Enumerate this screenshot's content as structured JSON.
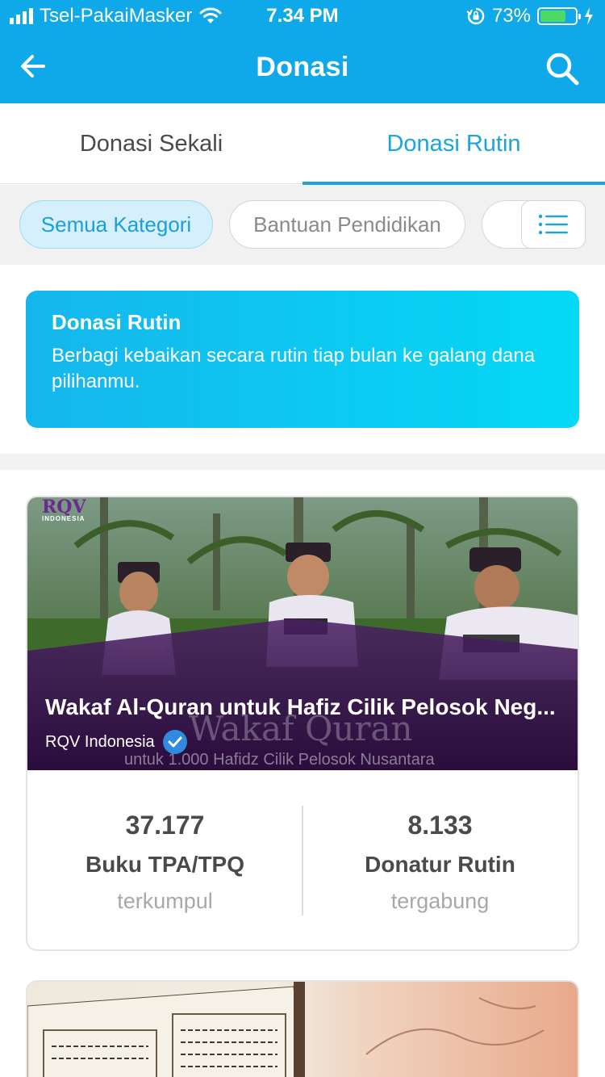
{
  "status_bar": {
    "carrier": "Tsel-PakaiMasker",
    "time": "7.34 PM",
    "battery_percent": "73%",
    "battery_level": 0.73
  },
  "nav": {
    "title": "Donasi",
    "back_icon": "back-arrow-icon",
    "search_icon": "search-icon"
  },
  "tabs": [
    {
      "label": "Donasi Sekali",
      "active": false
    },
    {
      "label": "Donasi Rutin",
      "active": true
    }
  ],
  "filters": {
    "chips": [
      {
        "label": "Semua Kategori",
        "active": true
      },
      {
        "label": "Bantuan Pendidikan",
        "active": false
      }
    ],
    "list_icon": "list-icon"
  },
  "banner": {
    "title": "Donasi Rutin",
    "text": "Berbagi kebaikan secara rutin tiap bulan ke galang dana pilihanmu."
  },
  "campaigns": [
    {
      "title": "Wakaf Al-Quran untuk Hafiz Cilik Pelosok Neg...",
      "org": "RQV Indonesia",
      "verified": true,
      "image_watermark_big": "Wakaf Quran",
      "image_watermark_small": "untuk 1.000 Hafidz Cilik Pelosok Nusantara",
      "logo_text": "RQV",
      "logo_subtext": "INDONESIA",
      "stats": [
        {
          "value": "37.177",
          "label": "Buku TPA/TPQ",
          "sub": "terkumpul"
        },
        {
          "value": "8.133",
          "label": "Donatur Rutin",
          "sub": "tergabung"
        }
      ]
    }
  ],
  "colors": {
    "primary": "#0fa8e8",
    "tab_active": "#1aa5de",
    "banner_start": "#16b6ec",
    "banner_end": "#04d9f6",
    "battery": "#4cd964"
  }
}
